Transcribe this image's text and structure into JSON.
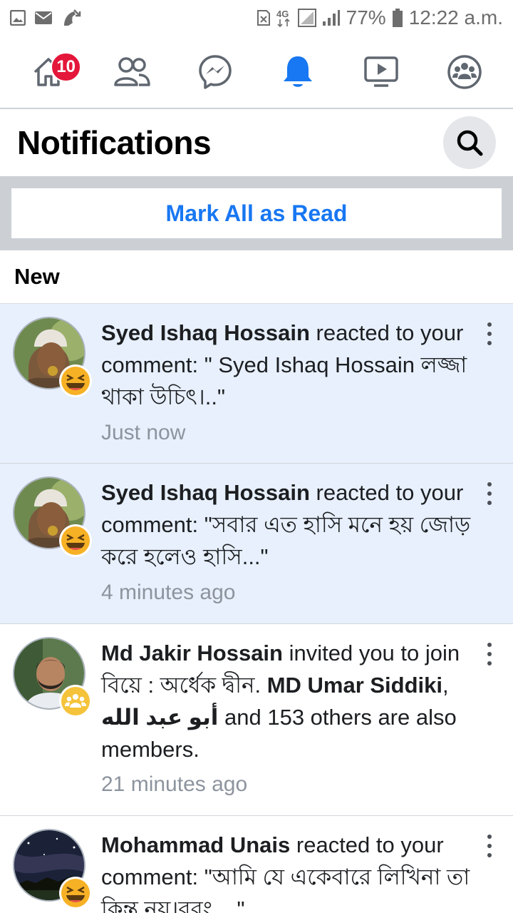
{
  "status_bar": {
    "battery_percent": "77%",
    "time": "12:22 a.m.",
    "network": "4G",
    "icons": [
      "gallery-icon",
      "mail-icon",
      "missed-call-icon",
      "sim-icon",
      "signal-icon",
      "battery-icon"
    ]
  },
  "nav": {
    "items": [
      {
        "name": "home",
        "icon": "home-icon",
        "badge": "10"
      },
      {
        "name": "friends",
        "icon": "friends-icon"
      },
      {
        "name": "messenger",
        "icon": "messenger-icon"
      },
      {
        "name": "notifications",
        "icon": "bell-icon",
        "active": true
      },
      {
        "name": "watch",
        "icon": "video-icon"
      },
      {
        "name": "groups",
        "icon": "groups-icon"
      }
    ],
    "active_color": "#1877f2"
  },
  "header": {
    "title": "Notifications"
  },
  "mark_all": {
    "label": "Mark All as Read"
  },
  "section": {
    "label": "New"
  },
  "notifications": [
    {
      "actor": "Syed Ishaq Hossain",
      "text": " reacted to your comment: \" Syed Ishaq Hossain লজ্জা থাকা উচিৎ।..\"",
      "time": "Just now",
      "reaction": "haha-icon",
      "unread": true
    },
    {
      "actor": "Syed Ishaq Hossain",
      "text": " reacted to your comment: \"সবার এত হাসি মনে হয় জোড় করে হলেও হাসি...\"",
      "time": "4 minutes ago",
      "reaction": "haha-icon",
      "unread": true
    },
    {
      "actor": "Md Jakir Hossain",
      "text_a": " invited you to join বিয়ে : অর্ধেক দ্বীন. ",
      "member1": "MD Umar Siddiki",
      "sep": ", ",
      "member2": "أبو عبد الله",
      "text_b": " and 153 others are also members.",
      "time": "21 minutes ago",
      "reaction": "group-icon",
      "unread": false
    },
    {
      "actor": "Mohammad Unais",
      "text": " reacted to your comment: \"আমি যে একেবারে লিখিনা তা কিন্তু নয়।বরং ...\"",
      "reaction": "haha-icon",
      "unread": false
    }
  ]
}
